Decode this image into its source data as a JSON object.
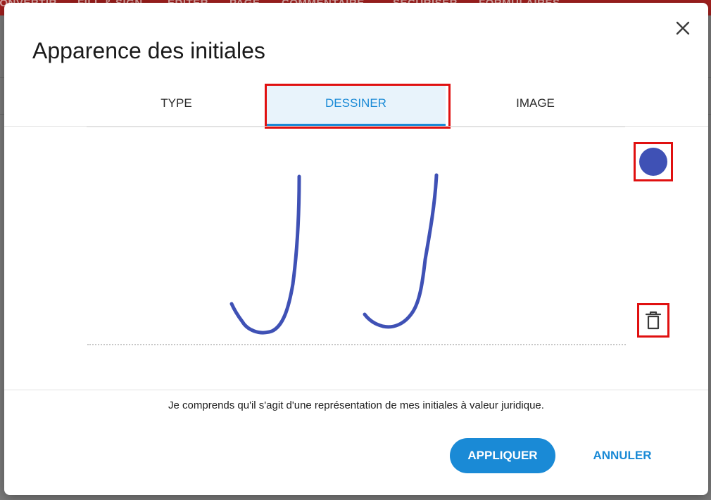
{
  "background_app": {
    "tabs": [
      "CONVERTIR",
      "FILL & SIGN",
      "ÉDITER",
      "PAGE",
      "COMMENTAIRE",
      "SÉCURISER",
      "FORMULAIRES"
    ],
    "active_tab_index": 1
  },
  "modal": {
    "title": "Apparence des initiales",
    "tabs": [
      {
        "label": "TYPE"
      },
      {
        "label": "DESSINER"
      },
      {
        "label": "IMAGE"
      }
    ],
    "active_tab_index": 1,
    "pen_color": "#3f51b5",
    "legal_text": "Je comprends qu'il s'agit d'une représentation de mes initiales à valeur juridique.",
    "apply_label": "APPLIQUER",
    "cancel_label": "ANNULER"
  },
  "colors": {
    "accent": "#1a8ad6",
    "highlight": "#e01010",
    "background_app_bar": "#a2201e"
  },
  "icons": [
    "close-icon",
    "color-swatch-icon",
    "trash-icon"
  ]
}
